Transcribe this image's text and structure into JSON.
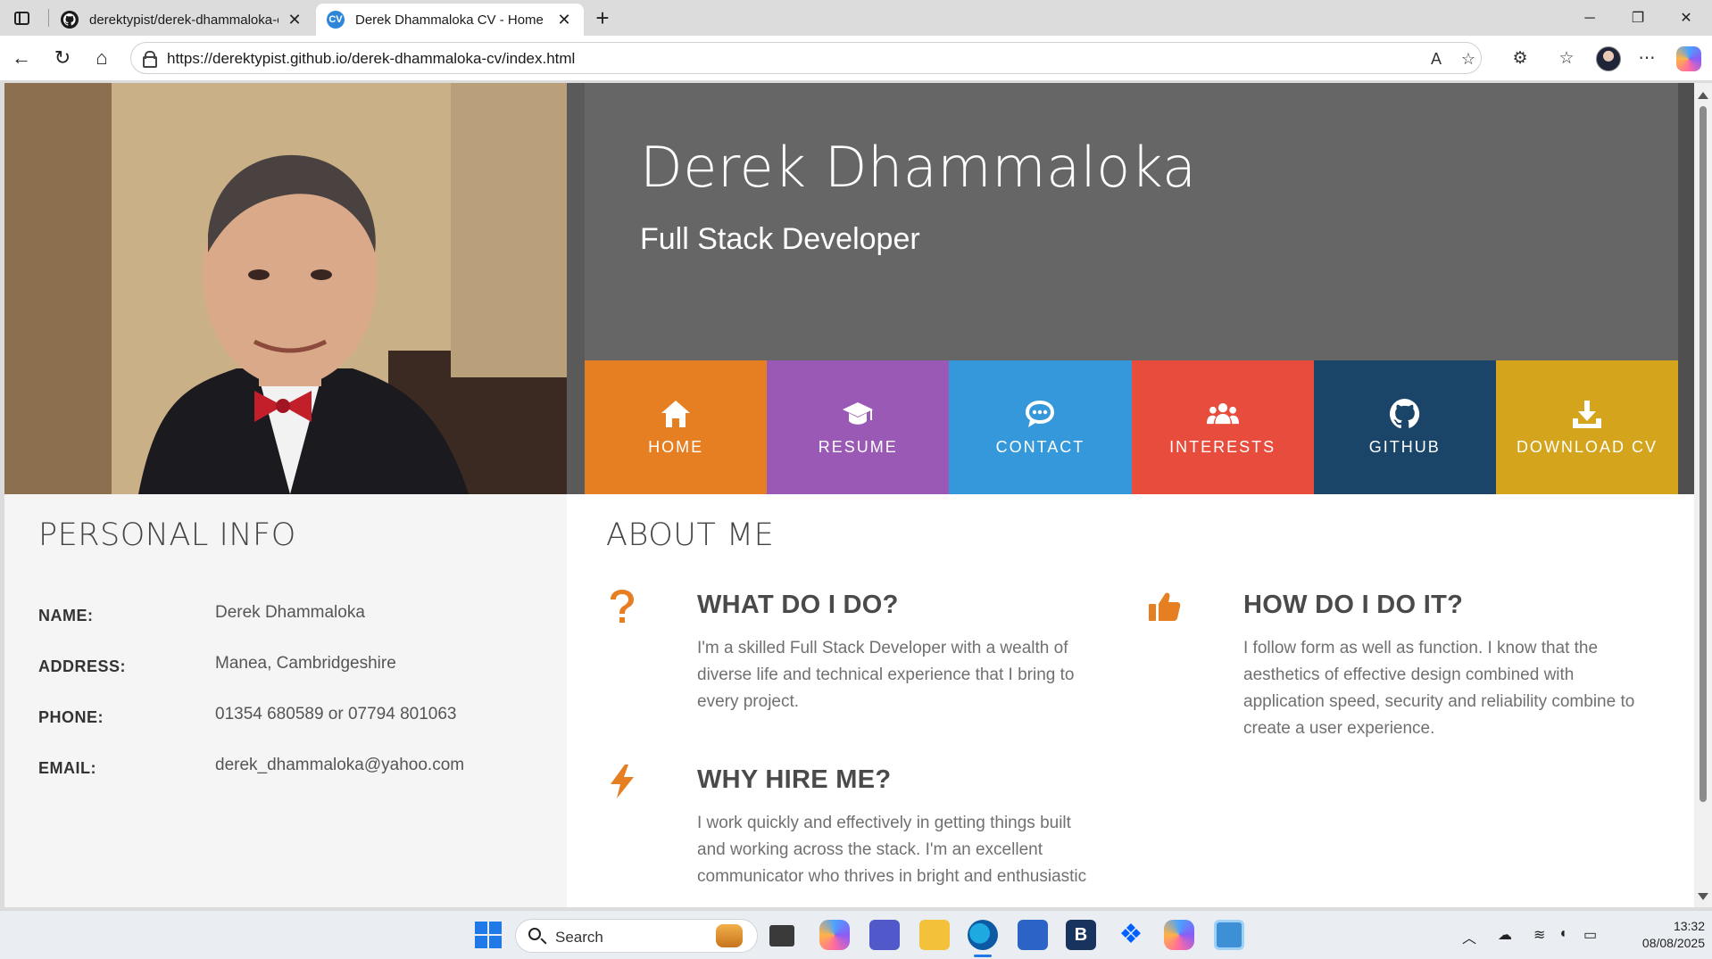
{
  "browser": {
    "tabs": [
      {
        "title": "derektypist/derek-dhammaloka-c",
        "favicon": "github-icon",
        "active": false
      },
      {
        "title": "Derek Dhammaloka CV - Home P",
        "favicon": "CV",
        "active": true
      }
    ],
    "url": "https://derektypist.github.io/derek-dhammaloka-cv/index.html"
  },
  "header": {
    "name": "Derek Dhammaloka",
    "role": "Full Stack Developer"
  },
  "nav": [
    {
      "label": "HOME",
      "icon": "home-icon",
      "color": "#E67E22"
    },
    {
      "label": "RESUME",
      "icon": "graduation-cap-icon",
      "color": "#9B59B6"
    },
    {
      "label": "CONTACT",
      "icon": "chat-icon",
      "color": "#3498DB"
    },
    {
      "label": "INTERESTS",
      "icon": "users-icon",
      "color": "#E74C3C"
    },
    {
      "label": "GITHUB",
      "icon": "github-icon",
      "color": "#1A4468"
    },
    {
      "label": "DOWNLOAD CV",
      "icon": "download-icon",
      "color": "#D4A41C"
    }
  ],
  "personal": {
    "title": "PERSONAL INFO",
    "rows": [
      {
        "label": "NAME:",
        "value": "Derek Dhammaloka"
      },
      {
        "label": "ADDRESS:",
        "value": "Manea, Cambridgeshire"
      },
      {
        "label": "PHONE:",
        "value": "01354 680589 or 07794 801063"
      },
      {
        "label": "EMAIL:",
        "value": "derek_dhammaloka@yahoo.com"
      }
    ]
  },
  "about": {
    "title": "ABOUT ME",
    "features": [
      {
        "icon": "question-icon",
        "title": "WHAT DO I DO?",
        "lines": [
          "I'm a skilled Full Stack Developer with a wealth of",
          "diverse life and technical experience that I bring to",
          "every project."
        ]
      },
      {
        "icon": "thumbs-up-icon",
        "title": "HOW DO I DO IT?",
        "lines": [
          "I follow form as well as function. I know that the",
          "aesthetics of effective design combined with",
          "application speed, security and reliability combine to",
          "create a user experience."
        ]
      },
      {
        "icon": "lightning-icon",
        "title": "WHY HIRE ME?",
        "lines": [
          "I work quickly and effectively in getting things built",
          "and working across the stack. I'm an excellent",
          "communicator who thrives in bright and enthusiastic"
        ]
      }
    ]
  },
  "taskbar": {
    "search": "Search",
    "time": "13:32",
    "date": "08/08/2025"
  },
  "colors": {
    "accent": "#E67E22",
    "header_bg": "#666666",
    "sidebar_bg": "#F5F5F5"
  }
}
